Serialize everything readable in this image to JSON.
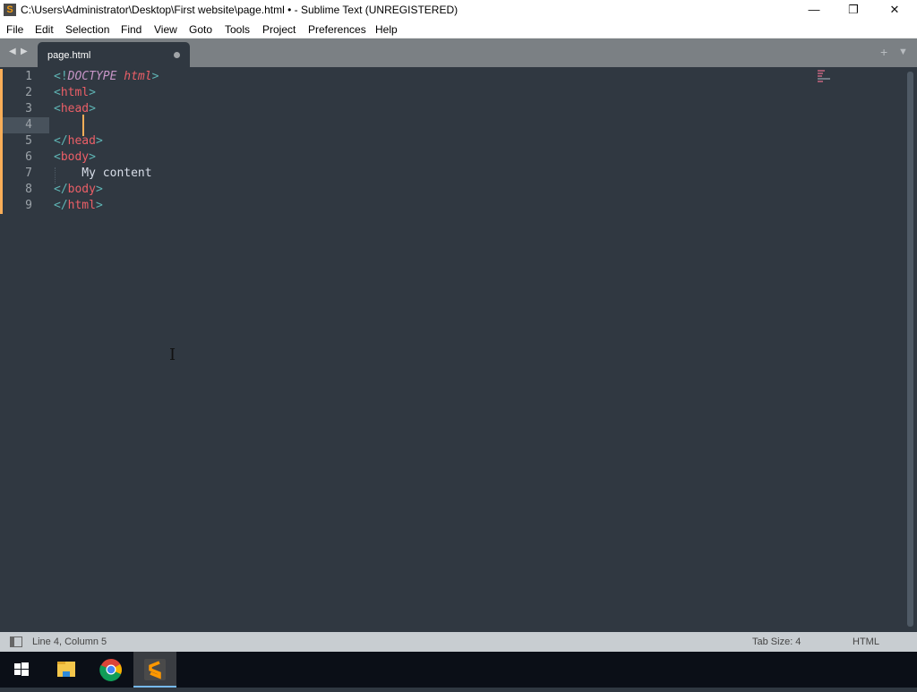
{
  "window": {
    "title": "C:\\Users\\Administrator\\Desktop\\First website\\page.html • - Sublime Text (UNREGISTERED)"
  },
  "menu": [
    "File",
    "Edit",
    "Selection",
    "Find",
    "View",
    "Goto",
    "Tools",
    "Project",
    "Preferences",
    "Help"
  ],
  "tab": {
    "label": "page.html",
    "dirty": true
  },
  "editor": {
    "current_line": 4,
    "lines": [
      [
        [
          "<!",
          "p"
        ],
        [
          "DOCTYPE",
          "d"
        ],
        [
          " ",
          "x"
        ],
        [
          "html",
          "a"
        ],
        [
          ">",
          "p"
        ]
      ],
      [
        [
          "<",
          "p"
        ],
        [
          "html",
          "t"
        ],
        [
          ">",
          "p"
        ]
      ],
      [
        [
          "<",
          "p"
        ],
        [
          "head",
          "t"
        ],
        [
          ">",
          "p"
        ]
      ],
      [],
      [
        [
          "</",
          "p"
        ],
        [
          "head",
          "t"
        ],
        [
          ">",
          "p"
        ]
      ],
      [
        [
          "<",
          "p"
        ],
        [
          "body",
          "t"
        ],
        [
          ">",
          "p"
        ]
      ],
      [
        [
          "    My content",
          "x"
        ]
      ],
      [
        [
          "</",
          "p"
        ],
        [
          "body",
          "t"
        ],
        [
          ">",
          "p"
        ]
      ],
      [
        [
          "</",
          "p"
        ],
        [
          "html",
          "t"
        ],
        [
          ">",
          "p"
        ]
      ]
    ]
  },
  "status": {
    "position": "Line 4, Column 5",
    "tab_size": "Tab Size: 4",
    "syntax": "HTML"
  },
  "taskbar": [
    "windows-start",
    "file-explorer",
    "chrome",
    "sublime-text"
  ]
}
